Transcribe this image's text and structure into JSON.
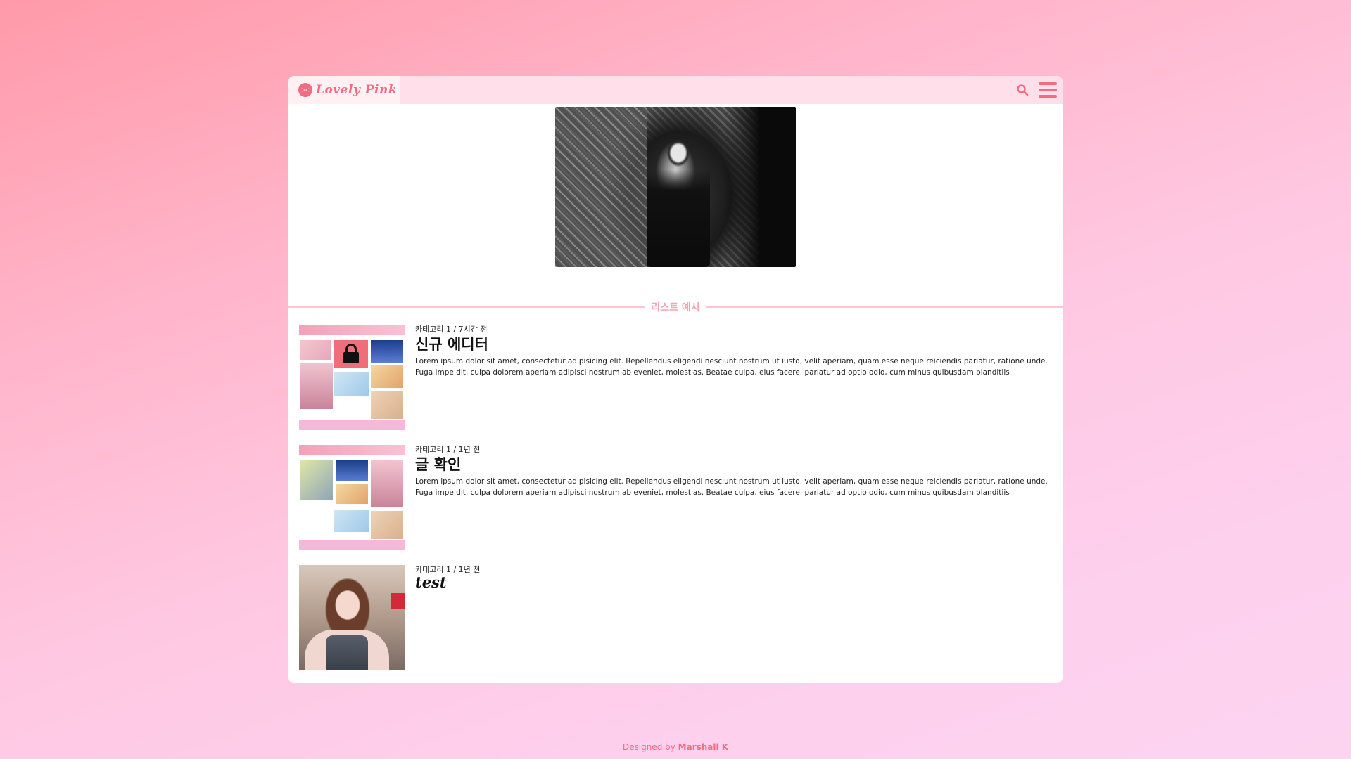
{
  "header": {
    "logo_text": "Lovely Pink",
    "logo_icon": "ribbon-icon",
    "search_icon": "search-icon",
    "menu_icon": "hamburger-menu-icon"
  },
  "section": {
    "title": "리스트 예시"
  },
  "posts": [
    {
      "meta": "카테고리 1 / 7시간 전",
      "title": "신규 에디터",
      "excerpt": "Lorem ipsum dolor sit amet, consectetur adipisicing elit. Repellendus eligendi nesciunt nostrum ut iusto, velit aperiam, quam esse neque reiciendis pariatur, ratione unde. Fuga impe dit, culpa dolorem aperiam adipisci nostrum ab eveniet, molestias. Beatae culpa, eius facere, pariatur ad optio odio, cum minus quibusdam blanditiis temporibus totam! As.."
    },
    {
      "meta": "카테고리 1 / 1년 전",
      "title": "글 확인",
      "excerpt": "Lorem ipsum dolor sit amet, consectetur adipisicing elit. Repellendus eligendi nesciunt nostrum ut iusto, velit aperiam, quam esse neque reiciendis pariatur, ratione unde. Fuga impe dit, culpa dolorem aperiam adipisci nostrum ab eveniet, molestias. Beatae culpa, eius facere, pariatur ad optio odio, cum minus quibusdam blanditiis temporibus totam! Aspernatur,"
    },
    {
      "meta": "카테고리 1 / 1년 전",
      "title": "test",
      "excerpt": ""
    }
  ],
  "footer": {
    "prefix": "Designed by ",
    "author": "Marshall K"
  },
  "colors": {
    "accent": "#f36b81",
    "topbar": "#ffe0ea",
    "divider": "#f6bcc9"
  }
}
